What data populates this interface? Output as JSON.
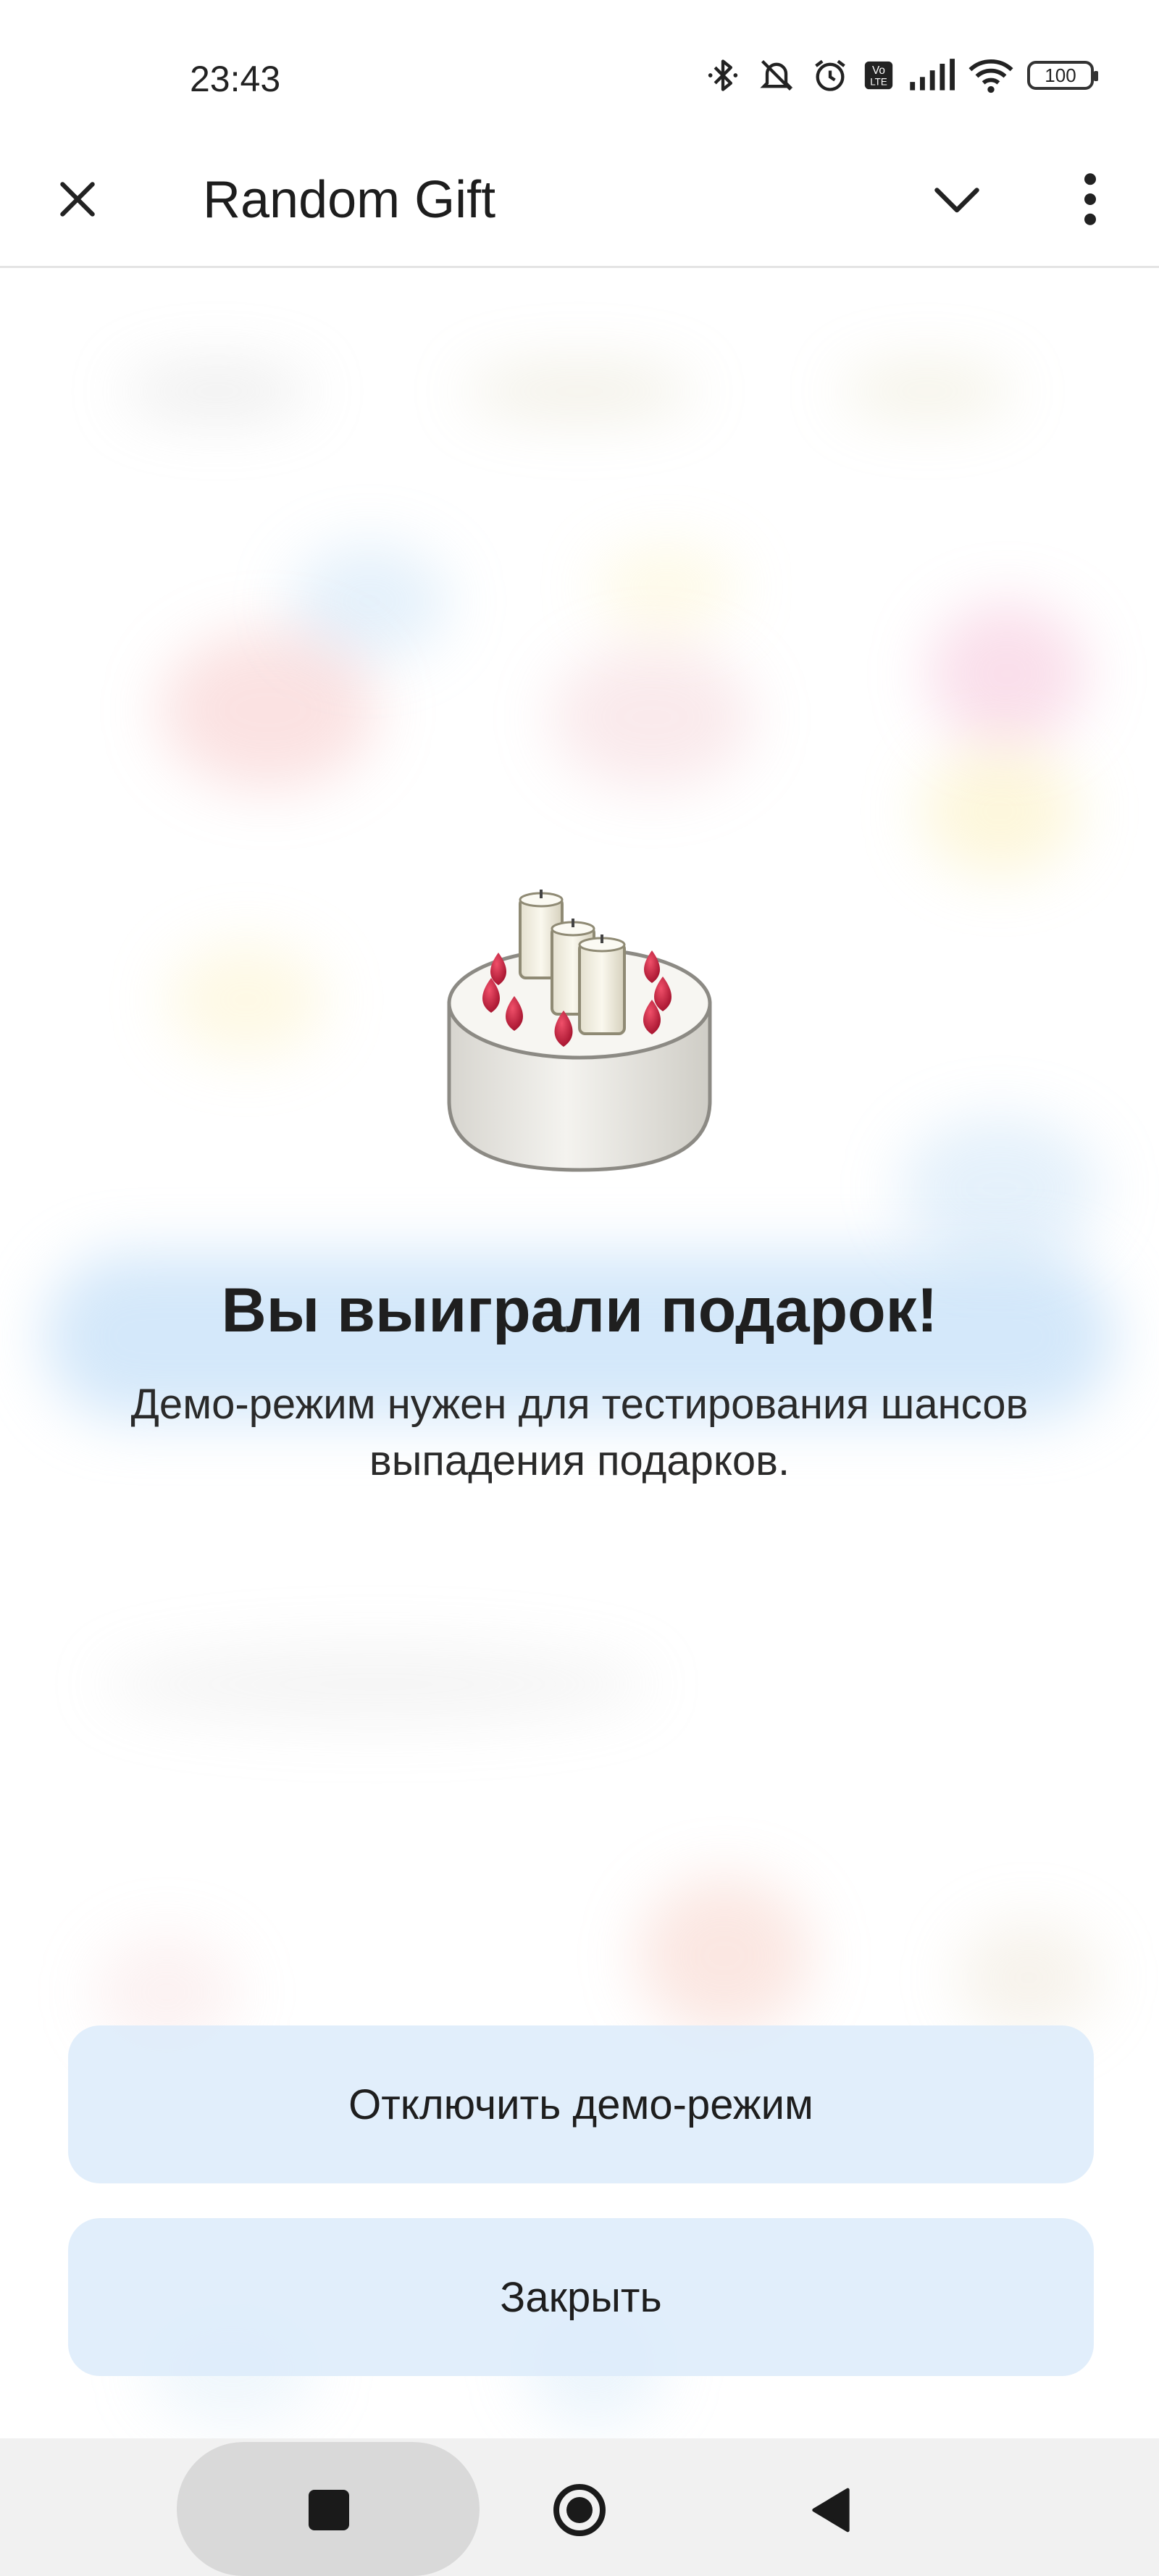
{
  "status_bar": {
    "time": "23:43",
    "battery": "100",
    "icons": [
      "bluetooth-icon",
      "mute-icon",
      "alarm-icon",
      "volte-icon",
      "signal-icon",
      "wifi-icon",
      "battery-icon"
    ]
  },
  "app_bar": {
    "title": "Random Gift",
    "icons": [
      "close-icon",
      "chevron-down-icon",
      "more-vert-icon"
    ]
  },
  "result": {
    "image": "birthday-cake-icon",
    "title": "Вы выиграли подарок!",
    "subtitle": "Демо-режим нужен для тестирования шансов выпадения подарков."
  },
  "buttons": {
    "disable_demo": "Отключить демо-режим",
    "close": "Закрыть"
  },
  "nav_bar": {
    "icons": [
      "recents-icon",
      "home-icon",
      "back-icon"
    ]
  },
  "colors": {
    "accent_button_bg": "#dcebfa",
    "nav_bar_bg": "#f1f1f1",
    "text_primary": "#1f1f1f"
  }
}
